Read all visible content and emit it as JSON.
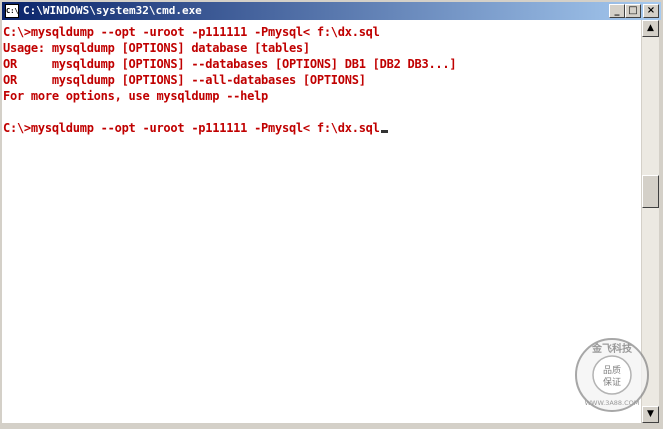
{
  "window": {
    "title": "C:\\WINDOWS\\system32\\cmd.exe",
    "icon_label": "C:\\",
    "buttons": {
      "minimize": "_",
      "maximize": "□",
      "close": "×"
    }
  },
  "console": {
    "text_color": "#c00000",
    "lines": [
      "C:\\>mysqldump --opt -uroot -p111111 -Pmysql< f:\\dx.sql",
      "Usage: mysqldump [OPTIONS] database [tables]",
      "OR     mysqldump [OPTIONS] --databases [OPTIONS] DB1 [DB2 DB3...]",
      "OR     mysqldump [OPTIONS] --all-databases [OPTIONS]",
      "For more options, use mysqldump --help",
      "",
      "C:\\>mysqldump --opt -uroot -p111111 -Pmysql< f:\\dx.sql"
    ]
  },
  "scrollbar": {
    "up_arrow": "▲",
    "down_arrow": "▼"
  },
  "watermark": {
    "top_text": "金飞科技",
    "middle_line1": "品质",
    "middle_line2": "保证",
    "bottom_text": "WWW.3A88.COM"
  }
}
